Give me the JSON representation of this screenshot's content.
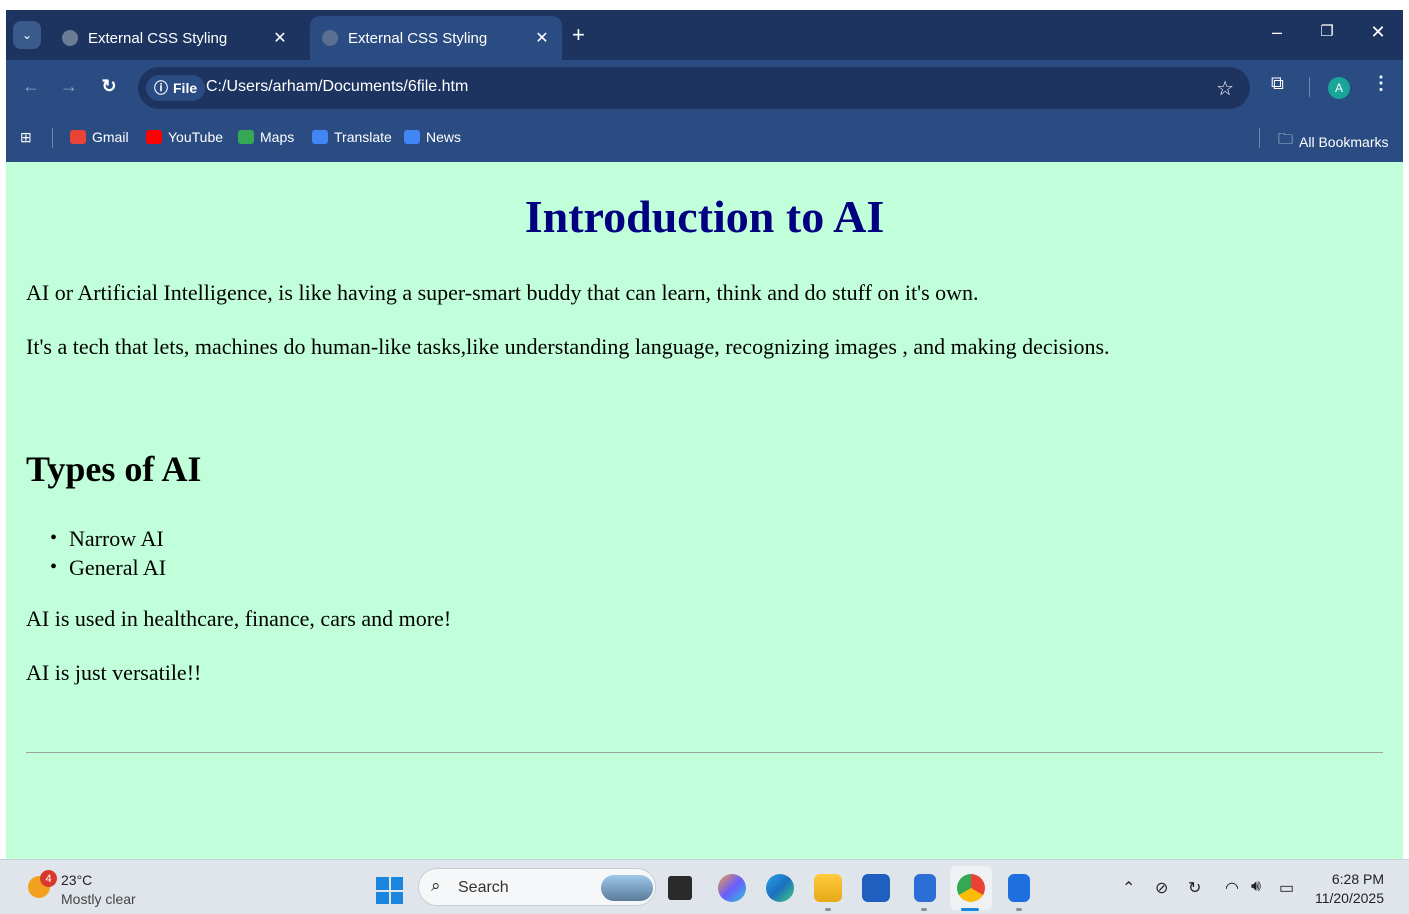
{
  "browser": {
    "tabs": [
      {
        "title": "External CSS Styling",
        "active": false
      },
      {
        "title": "External CSS Styling",
        "active": true
      }
    ],
    "url_scheme_label": "File",
    "url": "C:/Users/arham/Documents/6file.htm",
    "profile_initial": "A",
    "bookmarks": [
      {
        "label": "Gmail",
        "icon": "gmail-icon",
        "color": "#ea4335"
      },
      {
        "label": "YouTube",
        "icon": "youtube-icon",
        "color": "#ff0000"
      },
      {
        "label": "Maps",
        "icon": "maps-icon",
        "color": "#34a853"
      },
      {
        "label": "Translate",
        "icon": "translate-icon",
        "color": "#4285f4"
      },
      {
        "label": "News",
        "icon": "news-icon",
        "color": "#4285f4"
      }
    ],
    "all_bookmarks_label": "All Bookmarks"
  },
  "page": {
    "background": "#c1ffda",
    "title_color": "#000080",
    "title": "Introduction to AI",
    "intro_1": "AI or Artificial Intelligence, is like having a super-smart buddy that can learn, think and do stuff on it's own.",
    "intro_2": "It's a tech that lets, machines do human-like tasks,like understanding language, recognizing images , and making decisions.",
    "types_heading": "Types of AI",
    "types": [
      "Narrow AI",
      "General AI"
    ],
    "usage": "AI is used in healthcare, finance, cars and more!",
    "closing": "AI is just versatile!!"
  },
  "taskbar": {
    "weather_badge": "4",
    "temperature": "23°C",
    "condition": "Mostly clear",
    "search_placeholder": "Search",
    "time": "6:28 PM",
    "date": "11/20/2025"
  }
}
